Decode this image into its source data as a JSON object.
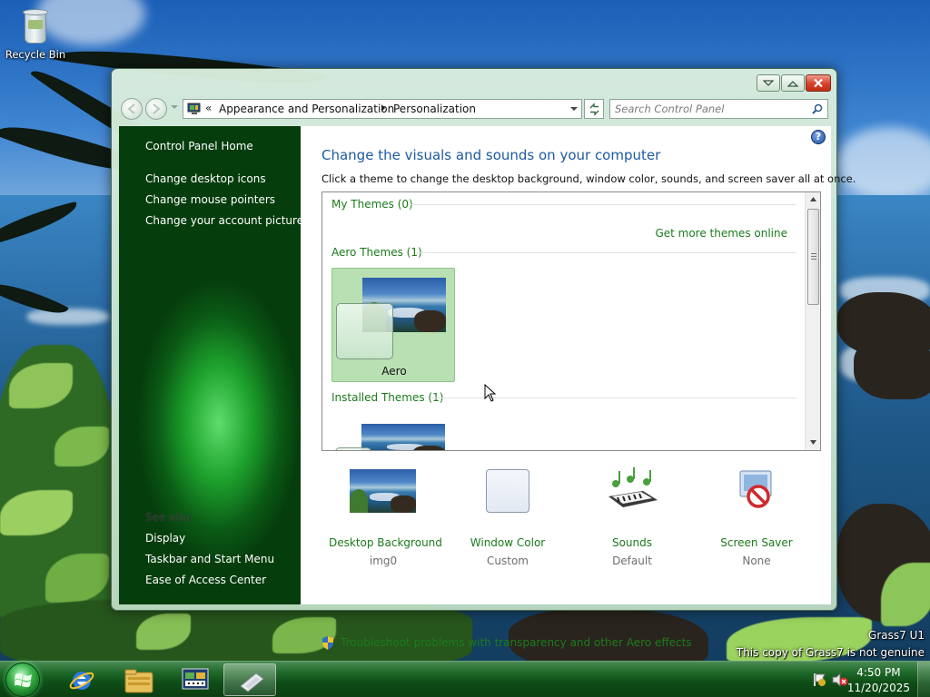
{
  "desktop": {
    "icons": [
      {
        "label": "Recycle Bin",
        "icon": "recycle-bin-icon"
      }
    ],
    "watermark": {
      "line1": "Grass7 U1",
      "line2": "This copy of Grass7 is not genuine"
    }
  },
  "window": {
    "caption_buttons": [
      "minimize",
      "maximize",
      "close"
    ],
    "address": {
      "overflow": "«",
      "breadcrumbs": [
        "Appearance and Personalization",
        "Personalization"
      ]
    },
    "search": {
      "placeholder": "Search Control Panel"
    },
    "left_pane": {
      "links": [
        "Control Panel Home",
        "Change desktop icons",
        "Change mouse pointers",
        "Change your account picture"
      ],
      "see_also_label": "See also",
      "see_also": [
        "Display",
        "Taskbar and Start Menu",
        "Ease of Access Center"
      ]
    },
    "content": {
      "title": "Change the visuals and sounds on your computer",
      "subtitle": "Click a theme to change the desktop background, window color, sounds, and screen saver all at once.",
      "groups": {
        "my_themes": "My Themes (0)",
        "get_more": "Get more themes online",
        "aero_themes": "Aero Themes (1)",
        "installed_themes": "Installed Themes (1)"
      },
      "selected_theme": {
        "name": "Aero"
      },
      "settings": [
        {
          "title": "Desktop Background",
          "value": "img0",
          "icon": "desktop-background-icon"
        },
        {
          "title": "Window Color",
          "value": "Custom",
          "icon": "window-color-icon"
        },
        {
          "title": "Sounds",
          "value": "Default",
          "icon": "sounds-icon"
        },
        {
          "title": "Screen Saver",
          "value": "None",
          "icon": "screen-saver-icon"
        }
      ],
      "troubleshoot": "Troubleshoot problems with transparency and other Aero effects"
    }
  },
  "taskbar": {
    "pinned": [
      "internet-explorer-icon",
      "windows-explorer-icon",
      "control-panel-icon",
      "personalization-icon"
    ],
    "clock": {
      "time": "4:50 PM",
      "date": "11/20/2025"
    },
    "colors": {
      "accent": "#1b7b1b",
      "taskbar": "#0e4d17"
    }
  }
}
